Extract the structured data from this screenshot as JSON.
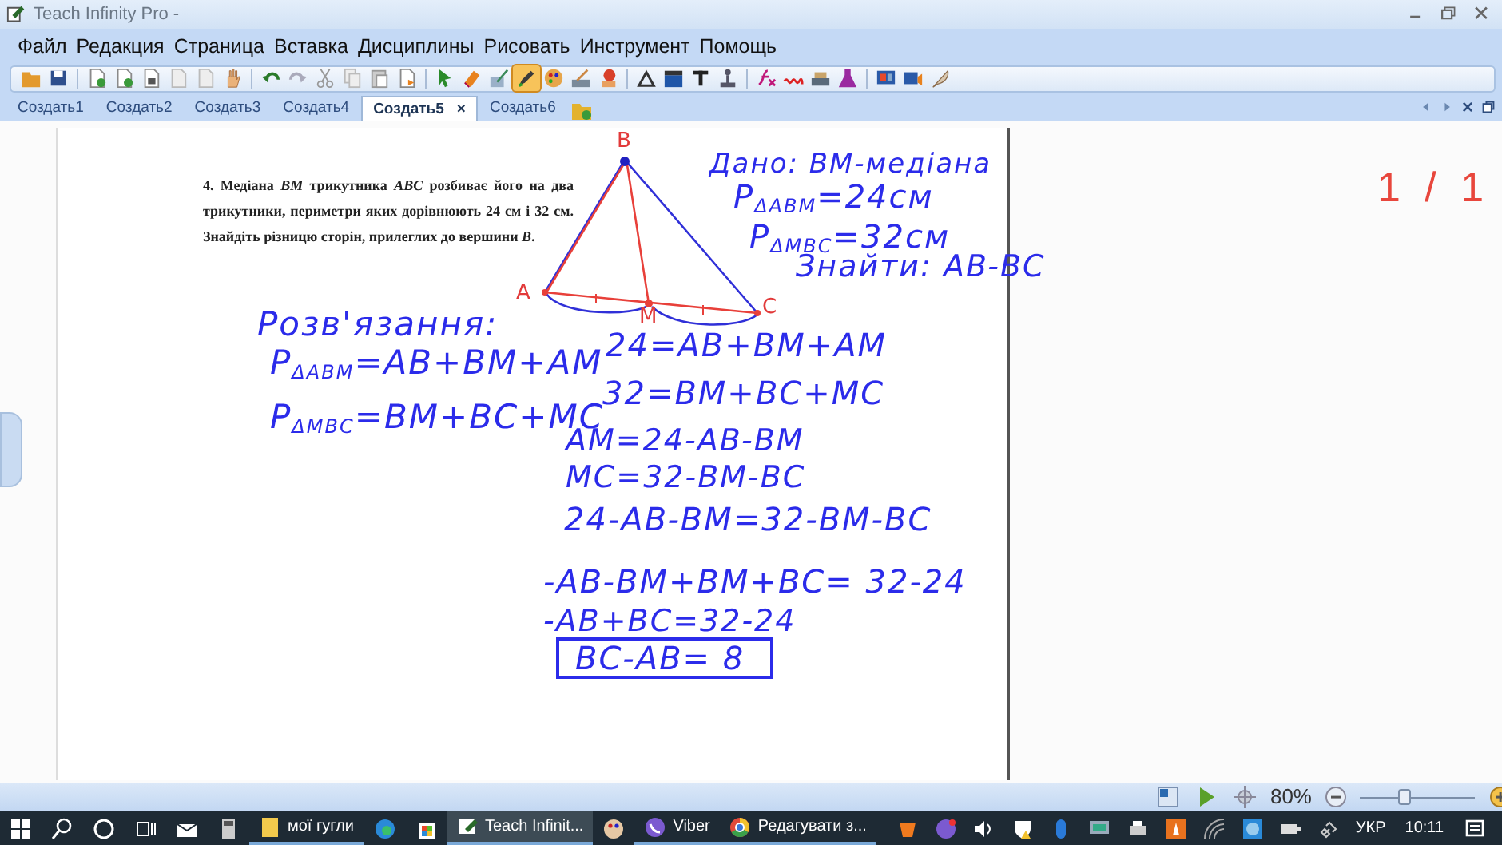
{
  "window": {
    "title": "Teach Infinity Pro -"
  },
  "menu": [
    "Файл",
    "Редакция",
    "Страница",
    "Вставка",
    "Дисциплины",
    "Рисовать",
    "Инструмент",
    "Помощь"
  ],
  "toolbar": {
    "tools": [
      {
        "selected": false
      },
      {
        "selected": false
      },
      {
        "selected": false
      },
      {
        "selected": false
      },
      {
        "selected": false
      },
      {
        "selected": false
      },
      {
        "selected": false
      },
      {
        "selected": false
      },
      {
        "selected": false
      },
      {
        "selected": false
      },
      {
        "selected": false
      },
      {
        "selected": false
      },
      {
        "selected": false
      },
      {
        "selected": false
      },
      {
        "selected": false
      },
      {
        "selected": false
      },
      {
        "selected": false
      },
      {
        "selected": true
      },
      {
        "selected": false
      },
      {
        "selected": false
      },
      {
        "selected": false
      },
      {
        "selected": false
      },
      {
        "selected": false
      },
      {
        "selected": false
      },
      {
        "selected": false
      },
      {
        "selected": false
      },
      {
        "selected": false
      },
      {
        "selected": false
      },
      {
        "selected": false
      },
      {
        "selected": false
      },
      {
        "selected": false
      },
      {
        "selected": false
      }
    ]
  },
  "tabs": {
    "close": "×",
    "items": [
      {
        "label": "Создать1",
        "selected": false
      },
      {
        "label": "Создать2",
        "selected": false
      },
      {
        "label": "Создать3",
        "selected": false
      },
      {
        "label": "Создать4",
        "selected": false
      },
      {
        "label": "Создать5",
        "selected": true
      },
      {
        "label": "Создать6",
        "selected": false
      }
    ]
  },
  "page": {
    "problem": "4. Медіана *BM* трикутника *ABC* розбиває його на два трикутники, периметри яких дорівнюють 24 см і 32 см. Знайдіть різницю сторін, прилеглих до вершини *B*.",
    "vertex_labels": [
      "B",
      "A",
      "M",
      "C"
    ],
    "handwriting": [
      {
        "text": "Дано: BM-медіана",
        "kind": "plain"
      },
      {
        "text": "P$_{ΔABM}$=24см",
        "kind": "plain"
      },
      {
        "text": "P$_{ΔMBC}$=32см",
        "kind": "plain"
      },
      {
        "text": "Знайти: AB-BC",
        "kind": "plain"
      },
      {
        "text": "Розв'язання:",
        "kind": "plain"
      },
      {
        "text": "P$_{ΔABM}$=AB+BM+AM",
        "kind": "plain"
      },
      {
        "text": "P$_{ΔMBC}$=BM+BC+MC",
        "kind": "plain"
      },
      {
        "text": "24=AB+BM+AM",
        "kind": "plain"
      },
      {
        "text": "32=BM+BC+MC",
        "kind": "plain"
      },
      {
        "text": "AM=24-AB-BM",
        "kind": "plain"
      },
      {
        "text": "MC=32-BM-BC",
        "kind": "plain"
      },
      {
        "text": "24-AB-BM=32-BM-BC",
        "kind": "plain"
      },
      {
        "text": "-AB-BM+BM+BC= 32-24",
        "kind": "plain"
      },
      {
        "text": "-AB+BC=32-24",
        "kind": "plain"
      },
      {
        "text": "BC-AB= 8",
        "kind": "boxed"
      }
    ]
  },
  "page_counter": "1 / 1",
  "status": {
    "zoom": "80%",
    "zoom_slider": {
      "level": 0.38
    }
  },
  "taskbar": {
    "apps": [
      {
        "label": "мої гугли",
        "selected": false
      },
      {
        "label": "Teach Infinit...",
        "selected": true
      },
      {
        "label": "Viber",
        "selected": false
      },
      {
        "label": "Редагувати з...",
        "selected": false
      }
    ],
    "language": "УКР",
    "time": "10:11"
  }
}
